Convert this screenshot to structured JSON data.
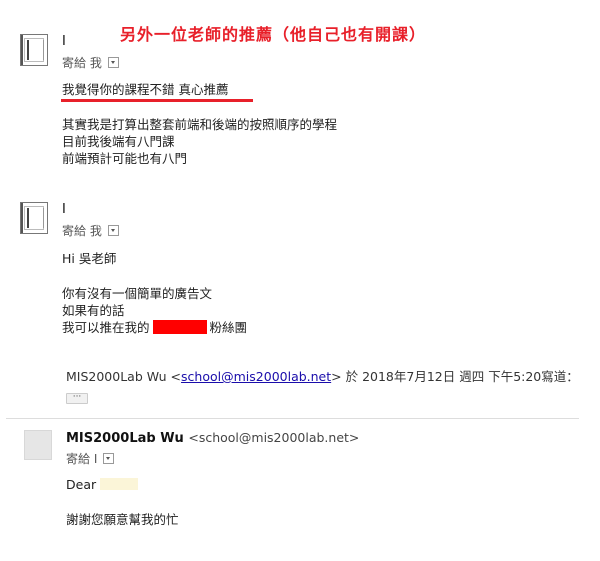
{
  "banner": "另外一位老師的推薦（他自己也有開課）",
  "emails": [
    {
      "sender": "I",
      "to_label": "寄給 我",
      "highlight": "我覺得你的課程不錯  真心推薦",
      "lines": [
        "其實我是打算出整套前端和後端的按照順序的學程",
        "目前我後端有八門課",
        "前端預計可能也有八門"
      ]
    },
    {
      "sender": "I",
      "to_label": "寄給 我",
      "greeting": "Hi  吳老師",
      "lines": [
        "你有沒有一個簡單的廣告文",
        "如果有的話"
      ],
      "line_prefix": "我可以推在我的",
      "line_suffix": "粉絲團",
      "quote_prefix": "MIS2000Lab Wu <",
      "quote_email": "school@mis2000lab.net",
      "quote_suffix": "> 於 2018年7月12日 週四 下午5:20寫道：",
      "more": "···"
    },
    {
      "sender": "MIS2000Lab Wu",
      "sender_email": "<school@mis2000lab.net>",
      "to_label": "寄給 I",
      "greeting": "Dear",
      "line": "謝謝您願意幫我的忙"
    }
  ],
  "colors": {
    "accent_red": "#e8202a",
    "link_blue": "#1a0dab",
    "redaction": "#ff0000"
  }
}
